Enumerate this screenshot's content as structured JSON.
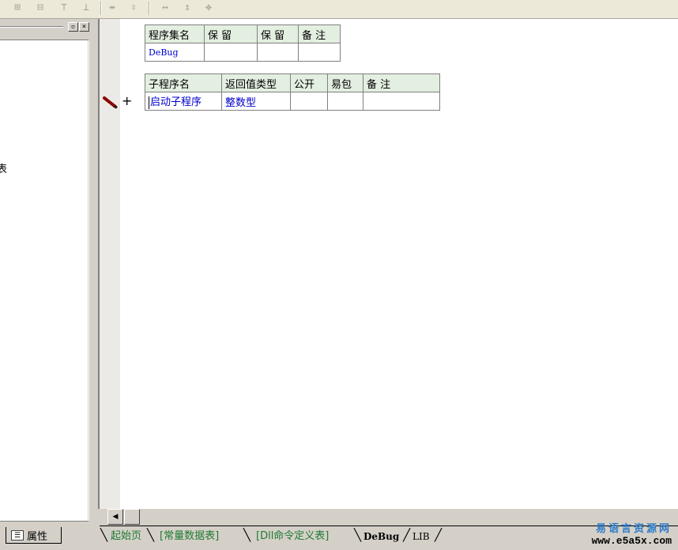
{
  "toolbar": {
    "icons": [
      "col-insert-icon",
      "row-insert-icon",
      "align-top-icon",
      "align-bottom-icon",
      "width-equal-icon",
      "height-equal-icon",
      "hsize-icon",
      "vsize-icon",
      "center-icon"
    ],
    "glyphs": [
      "⊞",
      "⊟",
      "⊤",
      "⊥",
      "⇹",
      "⇳",
      "↔",
      "↕",
      "✥"
    ]
  },
  "left_pane": {
    "stub_text": "表",
    "properties_tab_label": "属性"
  },
  "assembly_table": {
    "headers": [
      "程序集名",
      "保 留",
      "保 留",
      "备 注"
    ],
    "row": [
      "DeBug",
      "",
      "",
      ""
    ]
  },
  "sub_table": {
    "headers": [
      "子程序名",
      "返回值类型",
      "公开",
      "易包",
      "备 注"
    ],
    "row": [
      "启动子程序",
      "整数型",
      "",
      "",
      ""
    ]
  },
  "expand_symbol": "+",
  "doc_tabs": [
    {
      "label": "起始页",
      "color": "#1f7a32",
      "bold": false
    },
    {
      "label": "[常量数据表]",
      "color": "#1f7a32",
      "bold": false
    },
    {
      "label": "[Dll命令定义表]",
      "color": "#1f7a32",
      "bold": false
    },
    {
      "label": "DeBug",
      "color": "#000000",
      "bold": true
    },
    {
      "label": "LIB",
      "color": "#000000",
      "bold": false
    }
  ],
  "watermark": {
    "cn": "易语言资源网",
    "url": "www.e5a5x.com"
  },
  "colors": {
    "header_bg": "#e3efe0",
    "blue_text": "#0000cc",
    "tab_green": "#1f7a32"
  }
}
